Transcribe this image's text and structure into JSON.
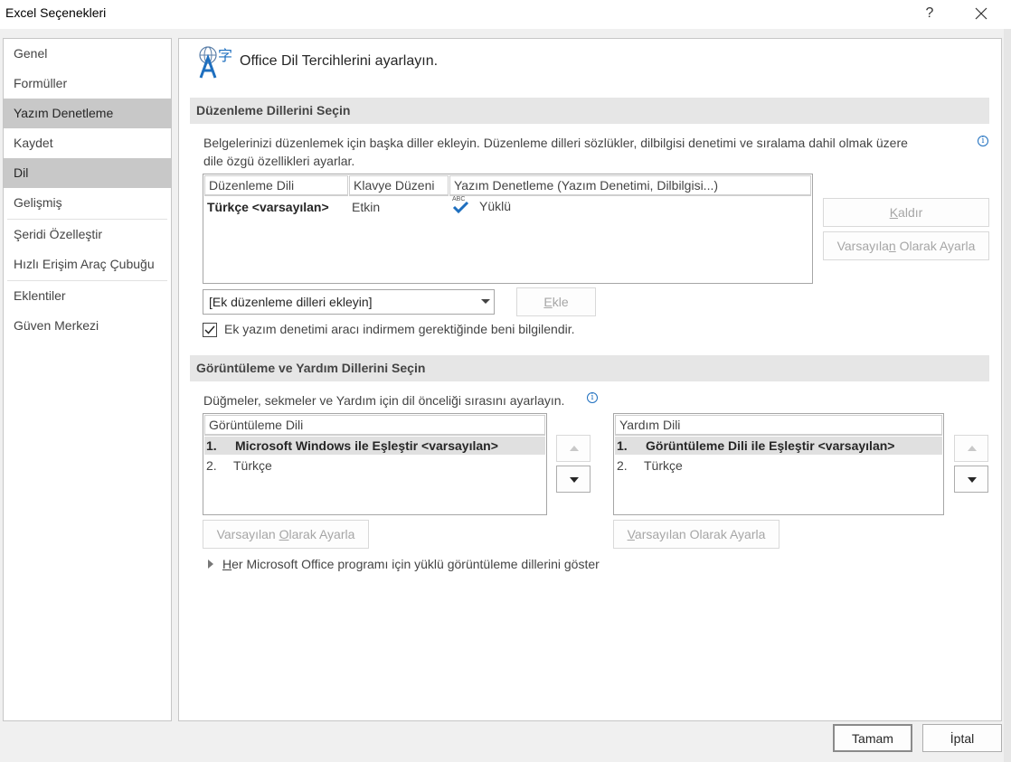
{
  "window": {
    "title": "Excel Seçenekleri",
    "help_label": "?"
  },
  "sidebar": {
    "items": [
      {
        "label": "Genel"
      },
      {
        "label": "Formüller"
      },
      {
        "label": "Yazım Denetleme"
      },
      {
        "label": "Kaydet"
      },
      {
        "label": "Dil"
      },
      {
        "label": "Gelişmiş"
      },
      {
        "label": "Şeridi Özelleştir"
      },
      {
        "label": "Hızlı Erişim Araç Çubuğu"
      },
      {
        "label": "Eklentiler"
      },
      {
        "label": "Güven Merkezi"
      }
    ],
    "selected": "Dil"
  },
  "header": {
    "title": "Office Dil Tercihlerini ayarlayın."
  },
  "editing": {
    "section_title": "Düzenleme Dillerini Seçin",
    "description_line1": "Belgelerinizi düzenlemek için başka diller ekleyin. Düzenleme dilleri sözlükler, dilbilgisi denetimi ve sıralama dahil olmak üzere",
    "description_line2": "dile özgü özellikleri ayarlar.",
    "columns": [
      "Düzenleme Dili",
      "Klavye Düzeni",
      "Yazım Denetleme (Yazım Denetimi, Dilbilgisi...)"
    ],
    "rows": [
      {
        "language": "Türkçe <varsayılan>",
        "keyboard": "Etkin",
        "proofing_badge": "ABC",
        "proofing": "Yüklü"
      }
    ],
    "remove_button": {
      "pre": "",
      "key": "K",
      "post": "aldır"
    },
    "set_default_button": {
      "pre": "Varsayıla",
      "key": "n",
      "post": " Olarak Ayarla"
    },
    "add_dropdown_value": "[Ek düzenleme dilleri ekleyin]",
    "add_button": {
      "pre": "",
      "key": "E",
      "post": "kle"
    },
    "notify_checkbox": {
      "label": "Ek yazım denetimi aracı indirmem gerektiğinde beni bilgilendir.",
      "checked": true
    }
  },
  "display": {
    "section_title": "Görüntüleme ve Yardım Dillerini Seçin",
    "description": "Düğmeler, sekmeler ve Yardım için dil önceliği sırasını ayarlayın.",
    "display_list": {
      "header": "Görüntüleme Dili",
      "items": [
        {
          "num": "1.",
          "label": "Microsoft Windows ile Eşleştir <varsayılan>"
        },
        {
          "num": "2.",
          "label": "Türkçe"
        }
      ]
    },
    "help_list": {
      "header": "Yardım Dili",
      "items": [
        {
          "num": "1.",
          "label": "Görüntüleme Dili ile Eşleştir <varsayılan>"
        },
        {
          "num": "2.",
          "label": "Türkçe"
        }
      ]
    },
    "display_default_button": {
      "pre": "Varsayılan ",
      "key": "O",
      "post": "larak Ayarla"
    },
    "help_default_button": {
      "pre": "",
      "key": "V",
      "post": "arsayılan Olarak Ayarla"
    },
    "expander_pre": "",
    "expander_key": "H",
    "expander_post": "er Microsoft Office programı için yüklü görüntüleme dillerini göster"
  },
  "footer": {
    "ok_label": "Tamam",
    "cancel_label": "İptal"
  },
  "colors": {
    "selected_nav": "#c8c8c8",
    "section_header": "#e6e6e6",
    "check_blue": "#1e6fbf"
  }
}
